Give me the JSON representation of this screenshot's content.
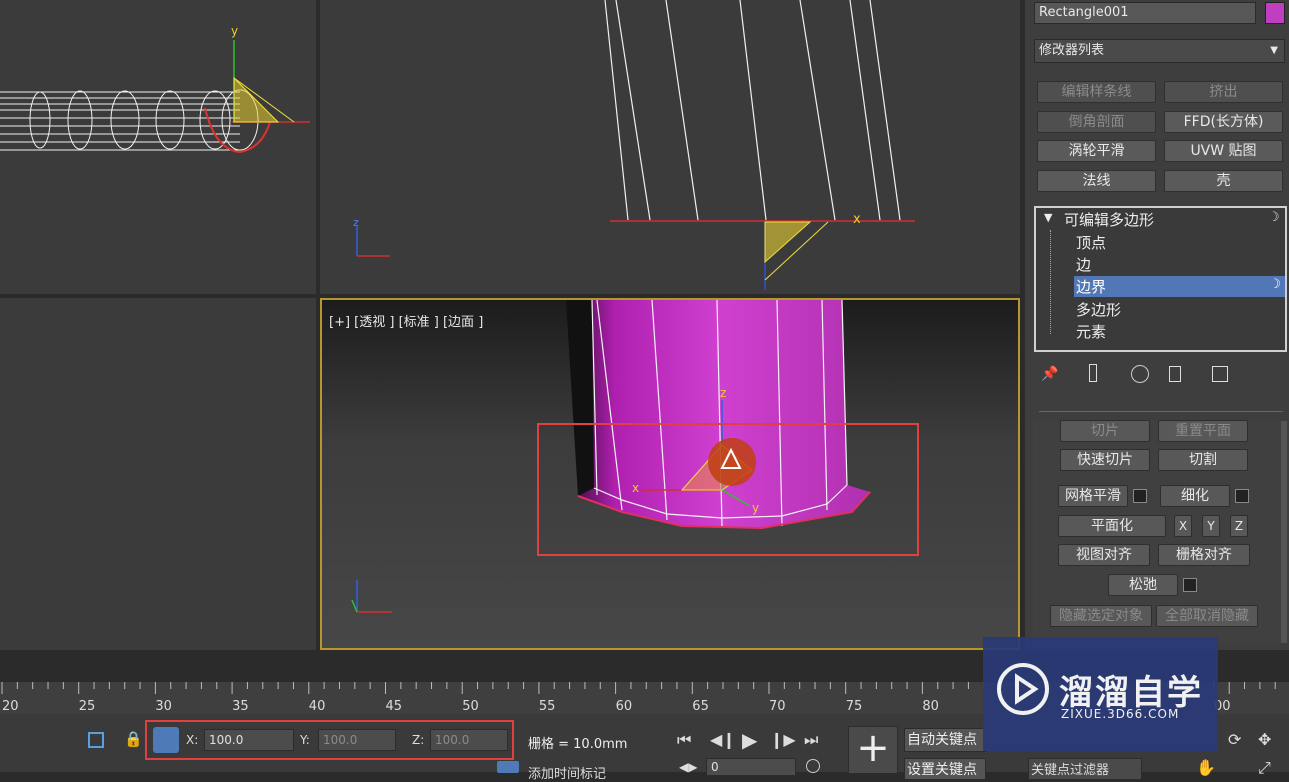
{
  "viewports": {
    "front": {
      "axis_y": "y"
    },
    "left": {
      "axis_x": "x",
      "axis_z": "z"
    },
    "bottom_left_axis": {
      "z": "z",
      "y": "y",
      "x": "x"
    },
    "perspective": {
      "label": "[+] [透视 ] [标准 ] [边面 ]",
      "gizmo_x": "x",
      "gizmo_y": "y",
      "gizmo_z": "z"
    }
  },
  "command_panel": {
    "object_name": "Rectangle001",
    "object_color": "#c03fc0",
    "modifier_list": "修改器列表",
    "modifier_buttons": [
      "编辑样条线",
      "挤出",
      "倒角剖面",
      "FFD(长方体)",
      "涡轮平滑",
      "UVW 贴图",
      "法线",
      "壳"
    ],
    "stack": {
      "root": "可编辑多边形",
      "items": [
        "顶点",
        "边",
        "边界",
        "多边形",
        "元素"
      ],
      "selected": "边界"
    },
    "edit_geometry": {
      "slice": "切片",
      "reset_plane": "重置平面",
      "quick_slice": "快速切片",
      "cut": "切割",
      "meshsmooth": "网格平滑",
      "tessellate": "细化",
      "make_planar": "平面化",
      "x": "X",
      "y": "Y",
      "z": "Z",
      "view_align": "视图对齐",
      "grid_align": "栅格对齐",
      "relax": "松弛",
      "hide_selected": "隐藏选定对象",
      "unhide_all": "全部取消隐藏"
    }
  },
  "timeline": {
    "ticks": [
      "20",
      "25",
      "30",
      "35",
      "40",
      "45",
      "50",
      "55",
      "60",
      "65",
      "70",
      "75",
      "80",
      "00"
    ]
  },
  "status_bar": {
    "x_label": "X:",
    "x_value": "100.0",
    "y_label": "Y:",
    "y_value": "100.0",
    "z_label": "Z:",
    "z_value": "100.0",
    "grid": "栅格 = 10.0mm",
    "auto_key": "自动关键点",
    "set_key": "设置关键点",
    "key_filter": "关键点过滤器",
    "add_time_tag": "添加时间标记",
    "frame_value": "0"
  },
  "watermark": {
    "title": "溜溜自学",
    "url": "ZIXUE.3D66.COM"
  }
}
